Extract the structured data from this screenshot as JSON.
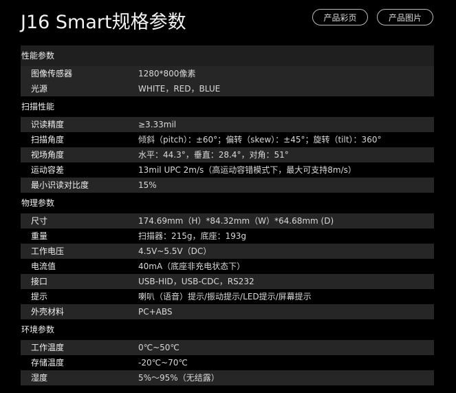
{
  "header": {
    "title": "J16 Smart规格参数",
    "buttons": {
      "colors": "产品彩页",
      "images": "产品图片"
    }
  },
  "sections": [
    {
      "title": "性能参数",
      "rows": [
        {
          "label": "图像传感器",
          "value": "1280*800像素"
        },
        {
          "label": "光源",
          "value": "WHITE，RED，BLUE"
        }
      ]
    },
    {
      "title": "扫描性能",
      "rows": [
        {
          "label": "识读精度",
          "value": "≥3.33mil"
        },
        {
          "label": "扫描角度",
          "value": "倾斜（pitch）：±60°；偏转（skew）：±45°；旋转（tilt）：360°"
        },
        {
          "label": "视场角度",
          "value": "水平：44.3°，垂直：28.4°，对角：51°"
        },
        {
          "label": "运动容差",
          "value": "13mil UPC 2m/s（高运动容错模式下，最大可支持8m/s）"
        },
        {
          "label": "最小识读对比度",
          "value": "15%"
        }
      ]
    },
    {
      "title": "物理参数",
      "rows": [
        {
          "label": "尺寸",
          "value": "174.69mm（H）*84.32mm（W）*64.68mm (D)"
        },
        {
          "label": "重量",
          "value": "扫描器：215g，底座：193g"
        },
        {
          "label": "工作电压",
          "value": "4.5V~5.5V（DC）"
        },
        {
          "label": "电流值",
          "value": "40mA（底座非充电状态下）"
        },
        {
          "label": "接口",
          "value": "USB-HID，USB-CDC，RS232"
        },
        {
          "label": "提示",
          "value": "喇叭（语音）提示/振动提示/LED提示/屏幕提示"
        },
        {
          "label": "外壳材料",
          "value": "PC+ABS"
        }
      ]
    },
    {
      "title": "环境参数",
      "rows": [
        {
          "label": "工作温度",
          "value": "0℃~50℃"
        },
        {
          "label": "存储温度",
          "value": "-20℃~70℃"
        },
        {
          "label": "湿度",
          "value": "5%～95%（无结露）"
        }
      ]
    }
  ]
}
